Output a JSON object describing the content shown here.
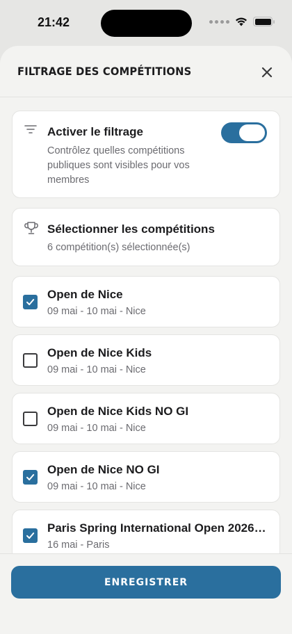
{
  "status_bar": {
    "time": "21:42"
  },
  "header": {
    "title": "FILTRAGE DES COMPÉTITIONS"
  },
  "filter": {
    "title": "Activer le filtrage",
    "description": "Contrôlez quelles compétitions publiques sont visibles pour vos membres",
    "enabled": true
  },
  "selection": {
    "title": "Sélectionner les compétitions",
    "summary": "6 compétition(s) sélectionnée(s)"
  },
  "competitions": [
    {
      "name": "Open de Nice",
      "details": "09 mai - 10 mai - Nice",
      "checked": true
    },
    {
      "name": "Open de Nice Kids",
      "details": "09 mai - 10 mai - Nice",
      "checked": false
    },
    {
      "name": "Open de Nice Kids NO GI",
      "details": "09 mai - 10 mai - Nice",
      "checked": false
    },
    {
      "name": "Open de Nice NO GI",
      "details": "09 mai - 10 mai - Nice",
      "checked": true
    },
    {
      "name": "Paris Spring International Open 2026…",
      "details": "16 mai - Paris",
      "checked": true
    }
  ],
  "footer": {
    "save_label": "ENREGISTRER"
  },
  "colors": {
    "accent": "#2a6f9e",
    "sheet_bg": "#f3f3f1",
    "card_bg": "#ffffff"
  }
}
